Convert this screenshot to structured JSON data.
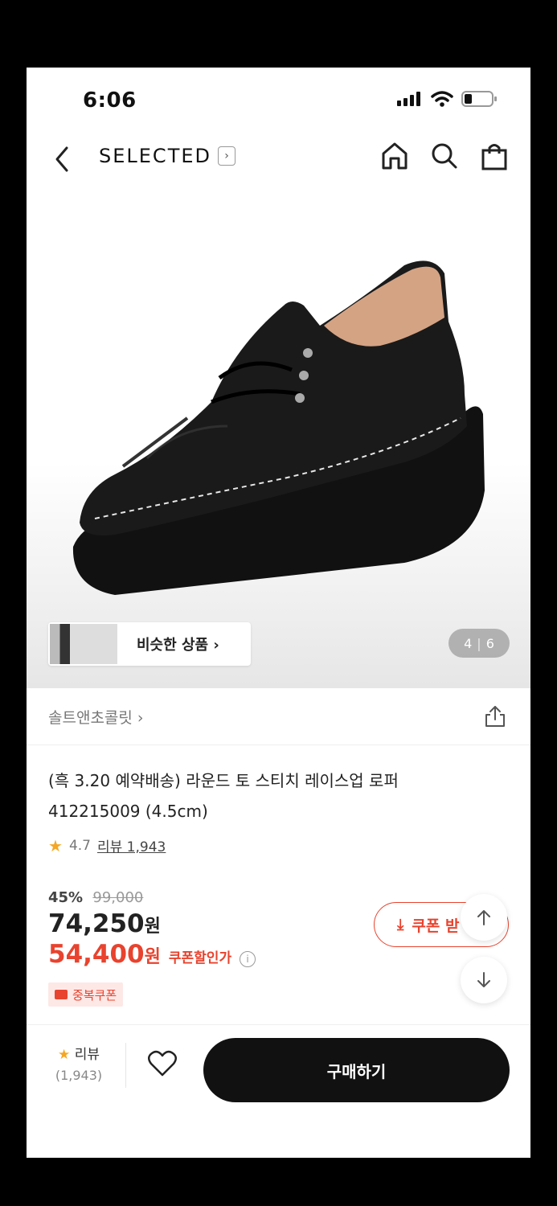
{
  "status": {
    "time": "6:06"
  },
  "nav": {
    "brand": "SELECTED"
  },
  "gallery": {
    "similar_label": "비슷한 상품 ›",
    "current": "4",
    "total": "6"
  },
  "product": {
    "seller": "솔트앤초콜릿 ›",
    "title_line1": "(흑 3.20 예약배송) 라운드 토 스티치 레이스업 로퍼",
    "title_line2": "412215009 (4.5cm)",
    "rating": "4.7",
    "reviews_link": "리뷰 1,943",
    "discount": "45%",
    "original_price": "99,000",
    "price": "74,250",
    "price_unit": "원",
    "coupon_price": "54,400",
    "coupon_price_unit": "원",
    "coupon_price_label": "쿠폰할인가",
    "dup_coupon": "중복쿠폰",
    "coupon_button": "쿠폰 받"
  },
  "bottom": {
    "review_label": "리뷰",
    "review_count": "(1,943)",
    "buy_label": "구매하기"
  },
  "colors": {
    "accent": "#e8432e",
    "buy_bg": "#111111"
  }
}
